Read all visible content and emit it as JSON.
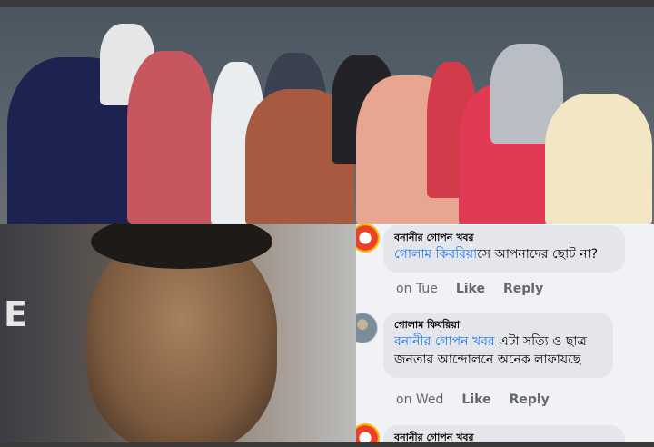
{
  "portrait": {
    "sign_letter": "E"
  },
  "comments": [
    {
      "author": "বনানীর গোপন খবর",
      "mention": "গোলাম কিবরিয়া",
      "text": "সে আপনাদের ছোট না?",
      "time": "on Tue",
      "like_label": "Like",
      "reply_label": "Reply",
      "avatar_icon": "page-logo-icon"
    },
    {
      "author": "গোলাম কিবরিয়া",
      "mention": "বনানীর গোপন খবর",
      "text": " এটা সত্যি ও ছাত্র জনতার আন্দোলনে অনেক লাফায়ছে",
      "time": "on Wed",
      "like_label": "Like",
      "reply_label": "Reply",
      "avatar_icon": "user-avatar-icon"
    },
    {
      "author": "বনানীর গোপন খবর",
      "avatar_icon": "page-logo-icon"
    }
  ],
  "colors": {
    "mention": "#1877f2",
    "bubble": "#e4e6eb",
    "meta": "#65676b",
    "panel": "#f0f2f5"
  }
}
